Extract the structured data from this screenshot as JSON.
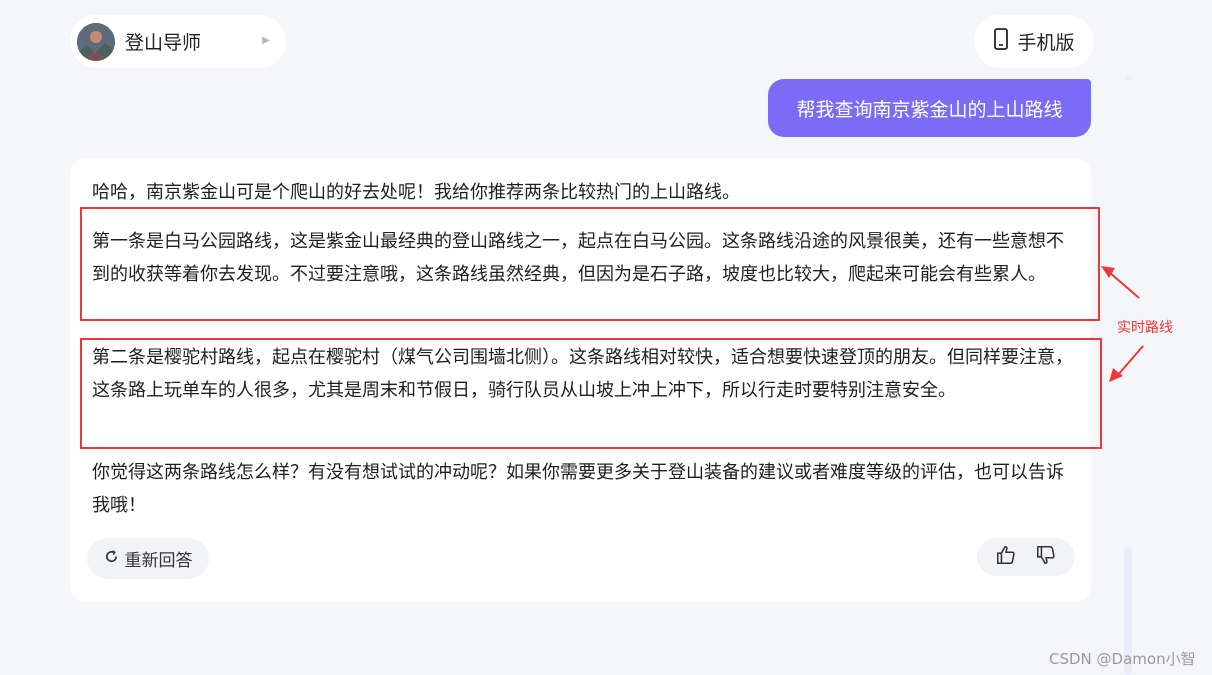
{
  "header": {
    "agent_name": "登山导师",
    "mobile_label": "手机版"
  },
  "user_message": "帮我查询南京紫金山的上山路线",
  "answer": {
    "intro": "哈哈，南京紫金山可是个爬山的好去处呢！我给你推荐两条比较热门的上山路线。",
    "route1": "第一条是白马公园路线，这是紫金山最经典的登山路线之一，起点在白马公园。这条路线沿途的风景很美，还有一些意想不到的收获等着你去发现。不过要注意哦，这条路线虽然经典，但因为是石子路，坡度也比较大，爬起来可能会有些累人。",
    "route2": "第二条是樱驼村路线，起点在樱驼村（煤气公司围墙北侧）。这条路线相对较快，适合想要快速登顶的朋友。但同样要注意，这条路上玩单车的人很多，尤其是周末和节假日，骑行队员从山坡上冲上冲下，所以行走时要特别注意安全。",
    "outro": "你觉得这两条路线怎么样？有没有想试试的冲动呢？如果你需要更多关于登山装备的建议或者难度等级的评估，也可以告诉我哦！",
    "regenerate_label": "重新回答"
  },
  "annotation": {
    "label": "实时路线",
    "color": "#e83a3a"
  },
  "watermark": "CSDN @Damon小智",
  "colors": {
    "user_bubble": "#7b6cf5",
    "background": "#f5f6fa"
  },
  "icons": {
    "agent_avatar": "avatar",
    "agent_chevron": "chevron-right-icon",
    "mobile": "phone-icon",
    "regenerate": "refresh-icon",
    "like": "thumbs-up-icon",
    "dislike": "thumbs-down-icon"
  }
}
